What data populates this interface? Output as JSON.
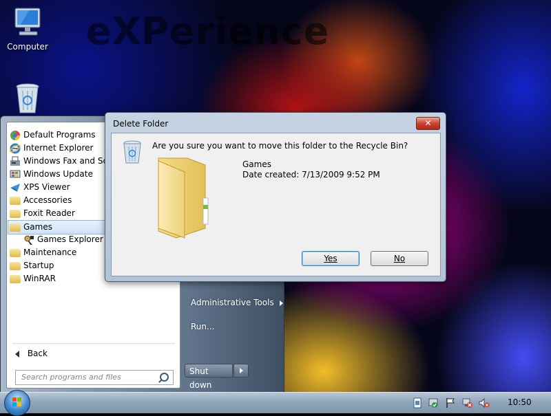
{
  "desktop": {
    "wallpaper_text": "eXPerience",
    "icons": [
      {
        "label": "Computer",
        "icon": "computer-icon"
      },
      {
        "label": "",
        "icon": "recycle-bin-icon"
      }
    ]
  },
  "start_menu": {
    "programs": [
      {
        "label": "Default Programs",
        "icon": "default-programs-icon"
      },
      {
        "label": "Internet Explorer",
        "icon": "internet-explorer-icon"
      },
      {
        "label": "Windows Fax and Scan",
        "icon": "fax-scan-icon"
      },
      {
        "label": "Windows Update",
        "icon": "windows-update-icon"
      },
      {
        "label": "XPS Viewer",
        "icon": "xps-viewer-icon"
      },
      {
        "label": "Accessories",
        "icon": "folder-icon"
      },
      {
        "label": "Foxit Reader",
        "icon": "folder-icon"
      },
      {
        "label": "Games",
        "icon": "folder-icon",
        "selected": true
      },
      {
        "label": "Games Explorer",
        "icon": "games-explorer-icon",
        "sub": true
      },
      {
        "label": "Maintenance",
        "icon": "folder-icon"
      },
      {
        "label": "Startup",
        "icon": "folder-icon"
      },
      {
        "label": "WinRAR",
        "icon": "folder-icon"
      }
    ],
    "back_label": "Back",
    "search_placeholder": "Search programs and files",
    "right_items": [
      {
        "label": "Administrative Tools",
        "has_arrow": true
      },
      {
        "label": "Run...",
        "has_arrow": false
      }
    ],
    "shutdown_label": "Shut down"
  },
  "dialog": {
    "title": "Delete Folder",
    "close_label": "✕",
    "question": "Are you sure you want to move this folder to the Recycle Bin?",
    "item_name": "Games",
    "item_date": "Date created: 7/13/2009 9:52 PM",
    "yes_label": "Yes",
    "no_label": "No"
  },
  "taskbar": {
    "clock": "10:50",
    "tray_icons": [
      "document-icon",
      "security-shield-icon",
      "action-center-flag-icon",
      "network-disconnected-icon",
      "volume-muted-icon"
    ]
  },
  "colors": {
    "dialog_title_bar": "#c6d3e3",
    "close_button": "#c84330",
    "selection_highlight": "#cfe3f7",
    "taskbar": "#8ea3b9"
  }
}
